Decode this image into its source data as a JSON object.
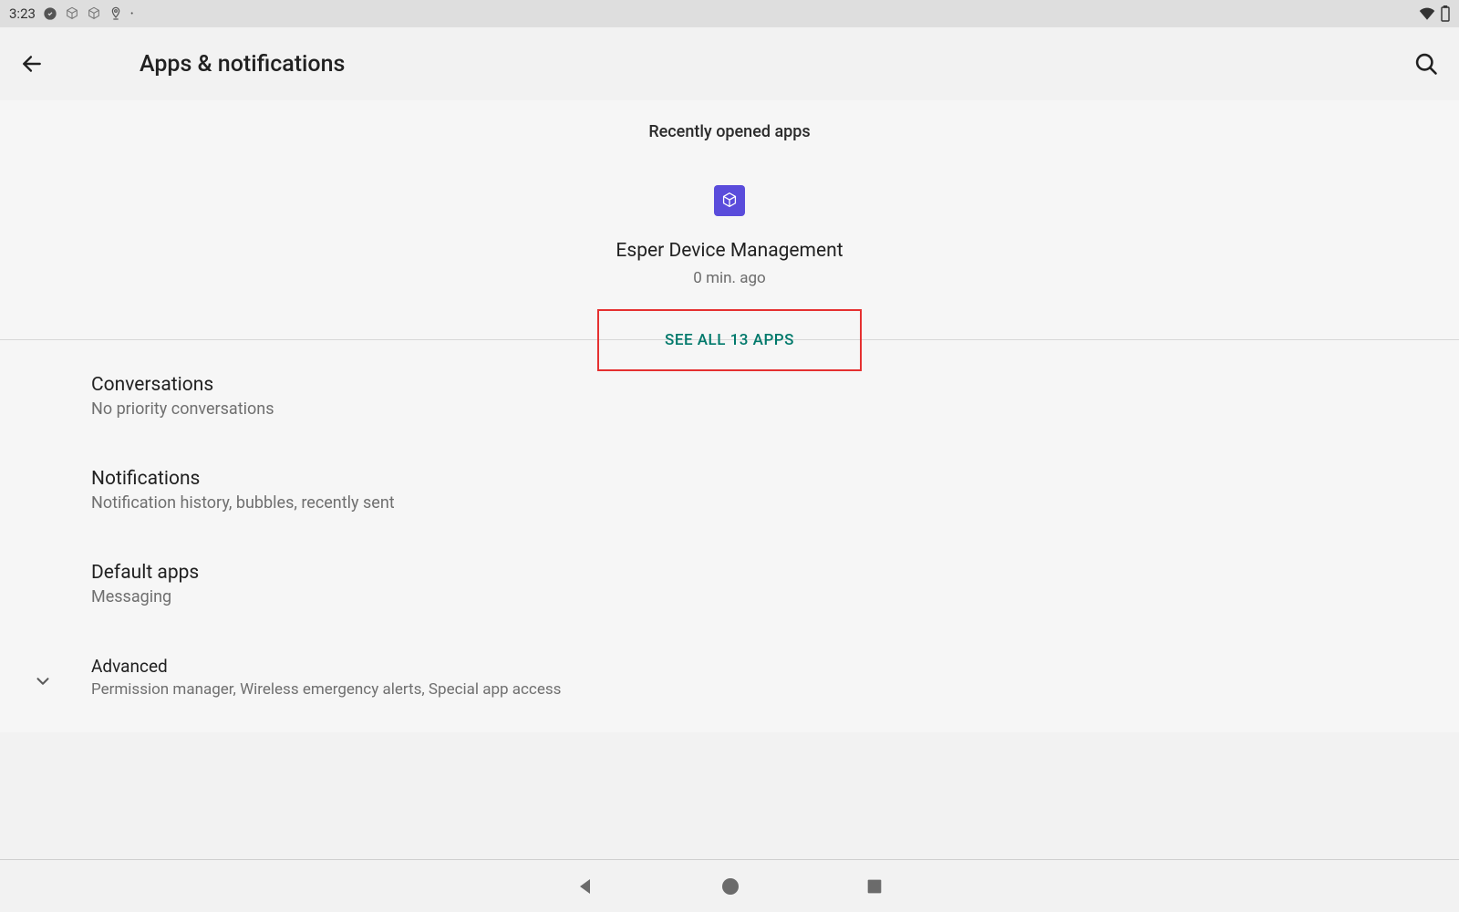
{
  "status_bar": {
    "time": "3:23"
  },
  "header": {
    "title": "Apps & notifications"
  },
  "recently_opened": {
    "header": "Recently opened apps",
    "app": {
      "name": "Esper Device Management",
      "time": "0 min. ago"
    },
    "see_all_label": "SEE ALL 13 APPS"
  },
  "settings": {
    "conversations": {
      "title": "Conversations",
      "subtitle": "No priority conversations"
    },
    "notifications": {
      "title": "Notifications",
      "subtitle": "Notification history, bubbles, recently sent"
    },
    "default_apps": {
      "title": "Default apps",
      "subtitle": "Messaging"
    },
    "advanced": {
      "title": "Advanced",
      "subtitle": "Permission manager, Wireless emergency alerts, Special app access"
    }
  }
}
